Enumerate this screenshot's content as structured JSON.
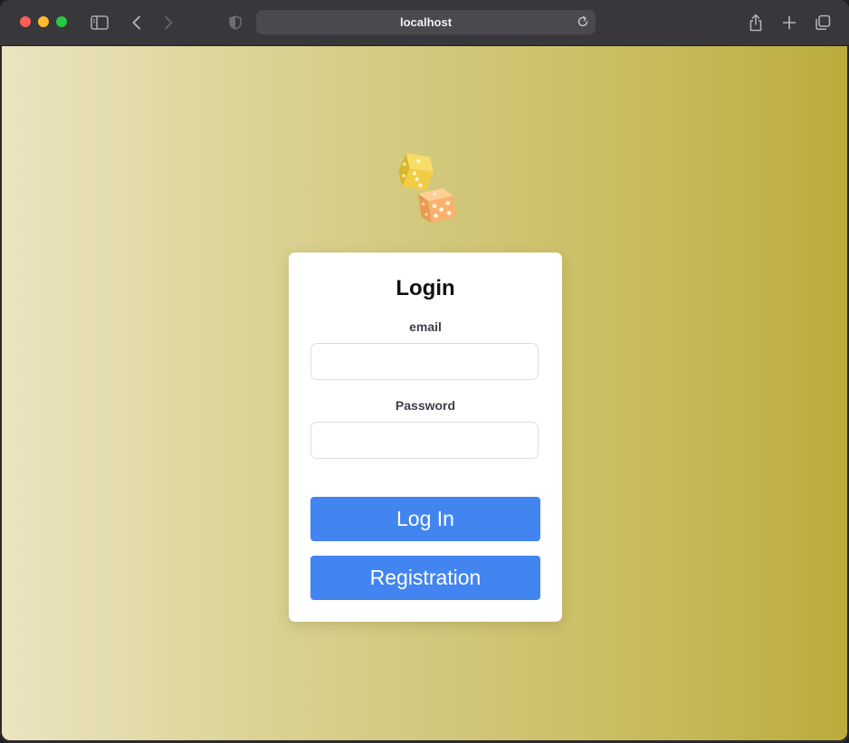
{
  "browser": {
    "address": "localhost",
    "icons": [
      "sidebar-icon",
      "back-icon",
      "forward-icon",
      "shield-icon",
      "reload-icon",
      "share-icon",
      "plus-icon",
      "tabs-icon"
    ]
  },
  "login": {
    "title": "Login",
    "email_label": "email",
    "email_value": "",
    "password_label": "Password",
    "password_value": "",
    "login_button": "Log In",
    "register_button": "Registration"
  },
  "colors": {
    "button": "#4285f0",
    "background_start": "#ebe4c0",
    "background_end": "#bbac3c"
  }
}
